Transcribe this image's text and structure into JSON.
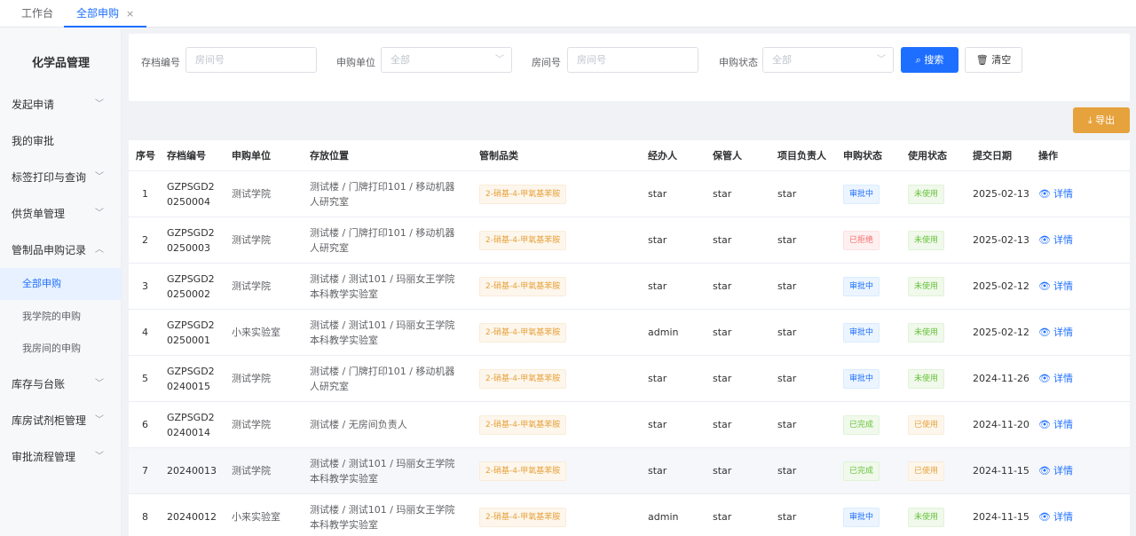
{
  "tabs": [
    {
      "label": "工作台"
    },
    {
      "label": "全部申购",
      "close": "×"
    }
  ],
  "sidebar": {
    "title": "化学品管理",
    "items": [
      {
        "label": "发起申请"
      },
      {
        "label": "我的审批"
      },
      {
        "label": "标签打印与查询"
      },
      {
        "label": "供货单管理"
      },
      {
        "label": "管制品申购记录"
      },
      {
        "label": "库存与台账"
      },
      {
        "label": "库房试剂柜管理"
      },
      {
        "label": "审批流程管理"
      }
    ],
    "subitems": [
      {
        "label": "全部申购"
      },
      {
        "label": "我学院的申购"
      },
      {
        "label": "我房间的申购"
      }
    ]
  },
  "filters": {
    "archive_label": "存档编号",
    "archive_placeholder": "房间号",
    "unit_label": "申购单位",
    "unit_value": "全部",
    "room_label": "房间号",
    "room_placeholder": "房间号",
    "status_label": "申购状态",
    "status_value": "全部",
    "search_button": "搜索",
    "clear_button": "清空"
  },
  "export_button": "导出",
  "table": {
    "headers": [
      "序号",
      "存档编号",
      "申购单位",
      "存放位置",
      "管制品类",
      "经办人",
      "保管人",
      "项目负责人",
      "申购状态",
      "使用状态",
      "提交日期",
      "操作"
    ],
    "detail_label": "详情",
    "rows": [
      {
        "no": "1",
        "code": "GZPSGD20250004",
        "unit": "测试学院",
        "loc_a": "测试楼",
        "loc_b": "门牌打印101",
        "loc_c": "移动机器人研究室",
        "category": "2-硝基-4-甲氧基苯胺",
        "handler": "star",
        "keeper": "star",
        "pi": "star",
        "status": "审批中",
        "status_color": "blue",
        "usage": "未使用",
        "usage_color": "green",
        "date": "2025-02-13"
      },
      {
        "no": "2",
        "code": "GZPSGD20250003",
        "unit": "测试学院",
        "loc_a": "测试楼",
        "loc_b": "门牌打印101",
        "loc_c": "移动机器人研究室",
        "category": "2-硝基-4-甲氧基苯胺",
        "handler": "star",
        "keeper": "star",
        "pi": "star",
        "status": "已拒绝",
        "status_color": "red",
        "usage": "未使用",
        "usage_color": "green",
        "date": "2025-02-13"
      },
      {
        "no": "3",
        "code": "GZPSGD20250002",
        "unit": "测试学院",
        "loc_a": "测试楼",
        "loc_b": "测试101",
        "loc_c": "玛丽女王学院本科教学实验室",
        "category": "2-硝基-4-甲氧基苯胺",
        "handler": "star",
        "keeper": "star",
        "pi": "star",
        "status": "审批中",
        "status_color": "blue",
        "usage": "未使用",
        "usage_color": "green",
        "date": "2025-02-12"
      },
      {
        "no": "4",
        "code": "GZPSGD20250001",
        "unit": "小来实验室",
        "loc_a": "测试楼",
        "loc_b": "测试101",
        "loc_c": "玛丽女王学院本科教学实验室",
        "category": "2-硝基-4-甲氧基苯胺",
        "handler": "admin",
        "keeper": "star",
        "pi": "star",
        "status": "审批中",
        "status_color": "blue",
        "usage": "未使用",
        "usage_color": "green",
        "date": "2025-02-12"
      },
      {
        "no": "5",
        "code": "GZPSGD20240015",
        "unit": "测试学院",
        "loc_a": "测试楼",
        "loc_b": "门牌打印101",
        "loc_c": "移动机器人研究室",
        "category": "2-硝基-4-甲氧基苯胺",
        "handler": "star",
        "keeper": "star",
        "pi": "star",
        "status": "审批中",
        "status_color": "blue",
        "usage": "未使用",
        "usage_color": "green",
        "date": "2024-11-26"
      },
      {
        "no": "6",
        "code": "GZPSGD20240014",
        "unit": "测试学院",
        "loc_a": "测试楼",
        "loc_b": "无房间负责人",
        "loc_c": "",
        "category": "2-硝基-4-甲氧基苯胺",
        "handler": "star",
        "keeper": "star",
        "pi": "star",
        "status": "已完成",
        "status_color": "green",
        "usage": "已使用",
        "usage_color": "orange",
        "date": "2024-11-20"
      },
      {
        "no": "7",
        "code": "20240013",
        "unit": "测试学院",
        "loc_a": "测试楼",
        "loc_b": "测试101",
        "loc_c": "玛丽女王学院本科教学实验室",
        "category": "2-硝基-4-甲氧基苯胺",
        "handler": "star",
        "keeper": "star",
        "pi": "star",
        "status": "已完成",
        "status_color": "green",
        "usage": "已使用",
        "usage_color": "orange",
        "date": "2024-11-15"
      },
      {
        "no": "8",
        "code": "20240012",
        "unit": "小来实验室",
        "loc_a": "测试楼",
        "loc_b": "测试101",
        "loc_c": "玛丽女王学院本科教学实验室",
        "category": "2-硝基-4-甲氧基苯胺",
        "handler": "admin",
        "keeper": "star",
        "pi": "star",
        "status": "审批中",
        "status_color": "blue",
        "usage": "未使用",
        "usage_color": "green",
        "date": "2024-11-15"
      }
    ]
  }
}
